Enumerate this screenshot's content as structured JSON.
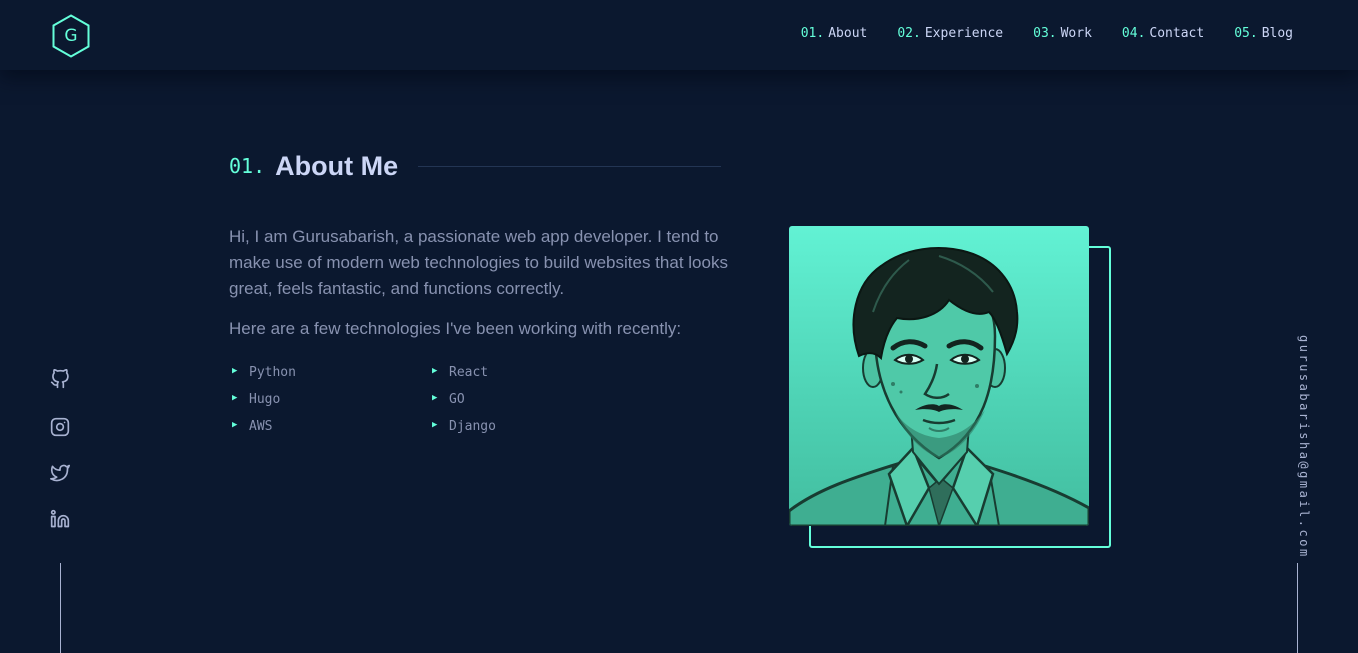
{
  "header": {
    "logo_letter": "G",
    "nav": [
      {
        "num": "01.",
        "label": "About"
      },
      {
        "num": "02.",
        "label": "Experience"
      },
      {
        "num": "03.",
        "label": "Work"
      },
      {
        "num": "04.",
        "label": "Contact"
      },
      {
        "num": "05.",
        "label": "Blog"
      }
    ]
  },
  "about": {
    "section_num": "01.",
    "section_title": "About Me",
    "bio": "Hi, I am Gurusabarish, a passionate web app developer. I tend to make use of modern web technologies to build websites that looks great, feels fantastic, and functions correctly.",
    "tech_intro": "Here are a few technologies I've been working with recently:",
    "technologies": [
      "Python",
      "React",
      "Hugo",
      "GO",
      "AWS",
      "Django"
    ]
  },
  "social": {
    "icons": [
      "github-icon",
      "instagram-icon",
      "twitter-icon",
      "linkedin-icon"
    ]
  },
  "email": "gurusabarisha@gmail.com",
  "colors": {
    "background": "#0b182f",
    "accent": "#64ffda",
    "heading": "#ccd6f6",
    "text": "#8892b0"
  }
}
